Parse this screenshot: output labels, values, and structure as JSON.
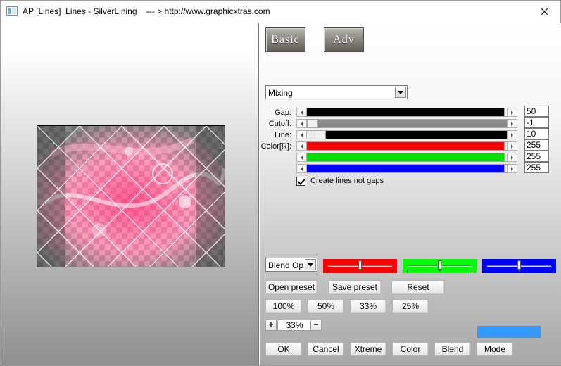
{
  "window": {
    "title": "AP [Lines]  Lines - SilverLining    --- > http://www.graphicxtras.com"
  },
  "tabs": {
    "basic_label": "Basic",
    "adv_label": "Adv"
  },
  "mixing_select": {
    "value": "Mixing"
  },
  "params": [
    {
      "label": "Gap:",
      "value": "50",
      "track_color": "#000000",
      "fraction": 1.0
    },
    {
      "label": "Cutoff:",
      "value": "-1",
      "track_color": "#888888",
      "fraction": 0.0
    },
    {
      "label": "Line:",
      "value": "10",
      "track_color": "#000000",
      "fraction": 0.04
    },
    {
      "label": "Color[R]:",
      "value": "255",
      "track_color": "#ff0000",
      "fraction": 1.0
    },
    {
      "label": "",
      "value": "255",
      "track_color": "#00dd00",
      "fraction": 1.0
    },
    {
      "label": "",
      "value": "255",
      "track_color": "#0000ff",
      "fraction": 1.0
    }
  ],
  "checkbox": {
    "label_before": "Create ",
    "label_hot": "l",
    "label_after": "ines not gaps",
    "checked": true
  },
  "blend_select": {
    "value": "Blend Options"
  },
  "color_sliders": [
    {
      "color": "#ff0000",
      "fraction": 0.5
    },
    {
      "color": "#00ff00",
      "fraction": 0.5
    },
    {
      "color": "#0000ff",
      "fraction": 0.5
    }
  ],
  "buttons": {
    "open_preset": "Open preset",
    "save_preset": "Save preset",
    "reset": "Reset",
    "zoom_100": "100%",
    "zoom_50": "50%",
    "zoom_33": "33%",
    "zoom_25": "25%"
  },
  "zoom": {
    "plus": "+",
    "minus": "−",
    "value": "33%"
  },
  "swatch": {
    "color": "#3399ff"
  },
  "bottom_buttons": {
    "ok": {
      "hot": "O",
      "rest": "K"
    },
    "cancel": {
      "hot": "C",
      "rest": "ancel"
    },
    "xtreme": {
      "hot": "X",
      "rest": "treme"
    },
    "color": {
      "hot": "C",
      "rest": "olor"
    },
    "blend": {
      "hot": "B",
      "rest": "lend"
    },
    "mode": {
      "hot": "M",
      "rest": "ode"
    }
  }
}
